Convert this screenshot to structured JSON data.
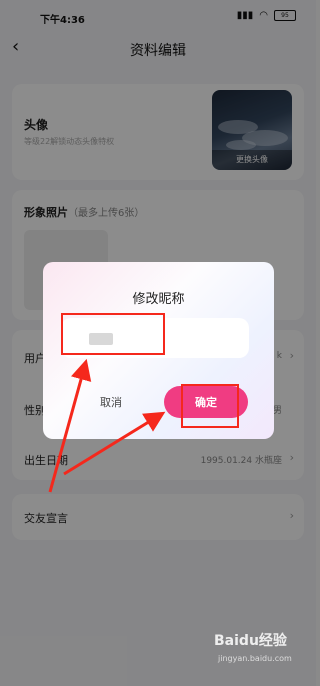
{
  "status_bar": {
    "time": "下午4:36",
    "battery": "95"
  },
  "nav": {
    "title": "资料编辑"
  },
  "avatar_card": {
    "title": "头像",
    "subtitle": "等级22解锁动态头像特权",
    "change_label": "更换头像"
  },
  "photo_card": {
    "title": "形象照片",
    "subtitle": "（最多上传6张）"
  },
  "profile_rows": [
    {
      "label": "用户",
      "value": "k"
    },
    {
      "label": "性别",
      "value": "男"
    },
    {
      "label": "出生日期",
      "value": "1995.01.24 水瓶座"
    }
  ],
  "declaration": {
    "label": "交友宣言"
  },
  "dialog": {
    "title": "修改昵称",
    "input_value": "",
    "cancel_label": "取消",
    "confirm_label": "确定"
  },
  "annotations": {
    "color": "#f5281c"
  },
  "watermark": {
    "brand": "Baidu经验",
    "url": "jingyan.baidu.com"
  }
}
